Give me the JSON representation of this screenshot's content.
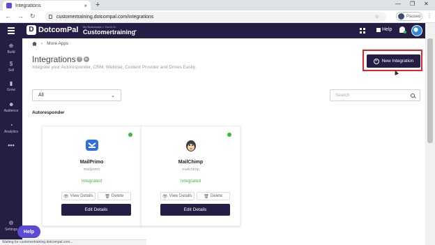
{
  "browser": {
    "tab_title": "Integrations",
    "url": "customertraining.dotcompal.com/integrations",
    "profile_state": "Paused"
  },
  "header": {
    "logo_text": "DotcomPal",
    "business_caption": "My Businesses > You're in",
    "business_name": "Customertraining",
    "help_label": "Help"
  },
  "sidebar": {
    "items": [
      {
        "label": "Build",
        "icon": "plus-circle-icon"
      },
      {
        "label": "Sell",
        "icon": "dollar-icon"
      },
      {
        "label": "Grow",
        "icon": "chart-icon"
      },
      {
        "label": "Audience",
        "icon": "people-icon"
      },
      {
        "label": "Analytics",
        "icon": "pie-icon"
      },
      {
        "label": "Settings",
        "icon": "gear-icon"
      }
    ]
  },
  "main": {
    "breadcrumb": {
      "section": "More Apps"
    },
    "title": "Integrations",
    "subtitle": "Integrate your Autoresponder, CRM, Webinar, Content Provider and Drives Easily.",
    "new_integration_label": "New Integration",
    "filter_value": "All",
    "search_placeholder": "Search",
    "section_label": "Autoresponder",
    "cards": [
      {
        "name": "MailPrimo",
        "id": "mailprimo",
        "status": "Integrated",
        "view_label": "View Details",
        "delete_label": "Delete",
        "edit_label": "Edit Details"
      },
      {
        "name": "MailChimp",
        "id": "mailchimp",
        "status": "Integrated",
        "view_label": "View Details",
        "delete_label": "Delete",
        "edit_label": "Edit Details"
      }
    ]
  },
  "help_float_label": "Help",
  "status_text": "Waiting for customertraining.dotcompal.com...",
  "colors": {
    "brand_dark": "#261d44",
    "accent": "#5b4bd6",
    "status_green": "#3dbb3d",
    "highlight_red": "#e32326"
  }
}
